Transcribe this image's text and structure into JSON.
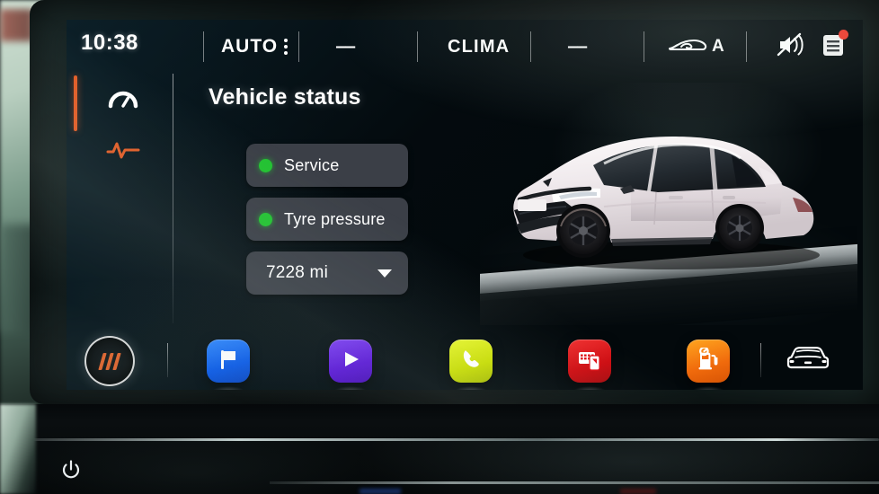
{
  "statusbar": {
    "time": "10:38",
    "climate_auto_label": "AUTO",
    "left_temp": "‒‒",
    "clima_label": "CLIMA",
    "right_temp": "‒‒",
    "recirculation_label": "A",
    "icons": {
      "recirculation": "car-airflow-icon",
      "sound_muted": "sound-muted-icon",
      "notifications": "notifications-list-icon"
    },
    "notification_badge": true,
    "overflow_menu": "three-dots-vertical"
  },
  "sidebar": {
    "items": [
      {
        "name": "driving-data",
        "icon": "gauge-icon",
        "active": false
      },
      {
        "name": "vehicle-status",
        "icon": "pulse-icon",
        "active": true
      }
    ],
    "accent_color": "#e25c26"
  },
  "main": {
    "title": "Vehicle status",
    "status_items": [
      {
        "label": "Service",
        "state_color": "#22c231",
        "state": "ok"
      },
      {
        "label": "Tyre pressure",
        "state_color": "#22c231",
        "state": "ok"
      }
    ],
    "mileage": {
      "value": "7228 mi",
      "caret": "chevron-down-icon"
    },
    "vehicle_image": "cupra-born-hatchback-white"
  },
  "dock": {
    "home": {
      "name": "home-button",
      "icon": "cupra-slashes-logo"
    },
    "apps": [
      {
        "name": "navigation",
        "icon": "flag-icon",
        "color": "#1a6ef5"
      },
      {
        "name": "media",
        "icon": "play-icon",
        "color": "#6a24e8"
      },
      {
        "name": "phone",
        "icon": "phone-handset-icon",
        "color": "#d7e90d"
      },
      {
        "name": "smartphone-projection",
        "icon": "phone-projection-icon",
        "color": "#e01117"
      },
      {
        "name": "fuel-stations",
        "icon": "fuel-pump-icon",
        "color": "#f6831a"
      }
    ],
    "vehicle_button": {
      "name": "vehicle-settings",
      "icon": "car-front-icon"
    }
  },
  "hardware": {
    "power_button": {
      "name": "power-button",
      "icon": "power-icon"
    }
  }
}
